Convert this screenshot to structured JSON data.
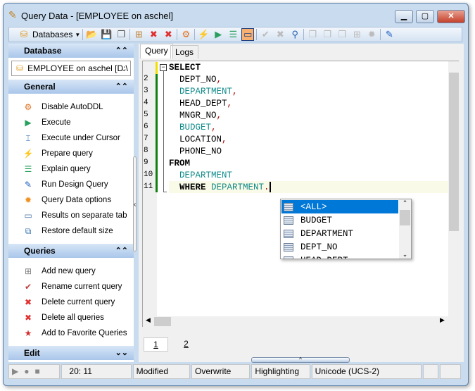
{
  "window": {
    "title": "Query Data - [EMPLOYEE on aschel]",
    "minimize": "▁",
    "maximize": "▢",
    "close": "✕"
  },
  "toolbar": {
    "databases_label": "Databases"
  },
  "sidebar": {
    "database": {
      "header": "Database",
      "selected": "EMPLOYEE on aschel [D:\\"
    },
    "general": {
      "header": "General",
      "items": [
        {
          "label": "Disable AutoDDL",
          "icon": "autoddl-icon",
          "glyph": "⚙",
          "color": "#e07020"
        },
        {
          "label": "Execute",
          "icon": "play-icon",
          "glyph": "▶",
          "color": "#2aa060"
        },
        {
          "label": "Execute under Cursor",
          "icon": "execute-cursor-icon",
          "glyph": "⌶",
          "color": "#2a6ab0"
        },
        {
          "label": "Prepare query",
          "icon": "lightning-icon",
          "glyph": "⚡",
          "color": "#f0b020"
        },
        {
          "label": "Explain query",
          "icon": "explain-icon",
          "glyph": "☰",
          "color": "#2aa060"
        },
        {
          "label": "Run Design Query",
          "icon": "design-query-icon",
          "glyph": "✎",
          "color": "#2060c0"
        },
        {
          "label": "Query Data options",
          "icon": "options-gear-icon",
          "glyph": "✹",
          "color": "#f09020"
        },
        {
          "label": "Results on separate tab",
          "icon": "separate-tab-icon",
          "glyph": "▭",
          "color": "#4070a0"
        },
        {
          "label": "Restore default size",
          "icon": "restore-size-icon",
          "glyph": "⧉",
          "color": "#3070b0"
        }
      ]
    },
    "queries": {
      "header": "Queries",
      "items": [
        {
          "label": "Add new query",
          "icon": "add-query-icon",
          "glyph": "⊞",
          "color": "#808080"
        },
        {
          "label": "Rename current query",
          "icon": "rename-query-icon",
          "glyph": "✔",
          "color": "#c04040"
        },
        {
          "label": "Delete current query",
          "icon": "delete-query-icon",
          "glyph": "✖",
          "color": "#e03030"
        },
        {
          "label": "Delete all queries",
          "icon": "delete-all-icon",
          "glyph": "✖",
          "color": "#e03030"
        },
        {
          "label": "Add to Favorite Queries",
          "icon": "favorite-add-icon",
          "glyph": "★",
          "color": "#d03030"
        }
      ]
    },
    "edit": {
      "header": "Edit"
    }
  },
  "tabs": [
    "Query",
    "Logs"
  ],
  "editor": {
    "lines": [
      [
        {
          "t": "SELECT",
          "c": "kw"
        }
      ],
      [
        {
          "t": "  DEPT_NO",
          "c": "id"
        },
        {
          "t": ",",
          "c": "p"
        }
      ],
      [
        {
          "t": "  DEPARTMENT",
          "c": "tbl"
        },
        {
          "t": ",",
          "c": "p"
        }
      ],
      [
        {
          "t": "  HEAD_DEPT",
          "c": "id"
        },
        {
          "t": ",",
          "c": "p"
        }
      ],
      [
        {
          "t": "  MNGR_NO",
          "c": "id"
        },
        {
          "t": ",",
          "c": "p"
        }
      ],
      [
        {
          "t": "  BUDGET",
          "c": "tbl"
        },
        {
          "t": ",",
          "c": "p"
        }
      ],
      [
        {
          "t": "  LOCATION",
          "c": "id"
        },
        {
          "t": ",",
          "c": "p"
        }
      ],
      [
        {
          "t": "  PHONE_NO",
          "c": "id"
        }
      ],
      [
        {
          "t": "FROM",
          "c": "kw"
        }
      ],
      [
        {
          "t": "  DEPARTMENT",
          "c": "tbl"
        }
      ],
      [
        {
          "t": "  WHERE ",
          "c": "kw"
        },
        {
          "t": "DEPARTMENT",
          "c": "tbl"
        },
        {
          "t": ".",
          "c": "p"
        }
      ]
    ],
    "line_numbers": [
      "",
      "2",
      "3",
      "4",
      "5",
      "6",
      "7",
      "8",
      "9",
      "10",
      "11"
    ],
    "autocomplete": [
      "<ALL>",
      "BUDGET",
      "DEPARTMENT",
      "DEPT_NO",
      "HEAD_DEPT"
    ]
  },
  "result_tabs": [
    "1",
    "2"
  ],
  "status": {
    "position": "20:  11",
    "modified": "Modified",
    "mode": "Overwrite",
    "highlighting": "Highlighting",
    "encoding": "Unicode (UCS-2)"
  }
}
